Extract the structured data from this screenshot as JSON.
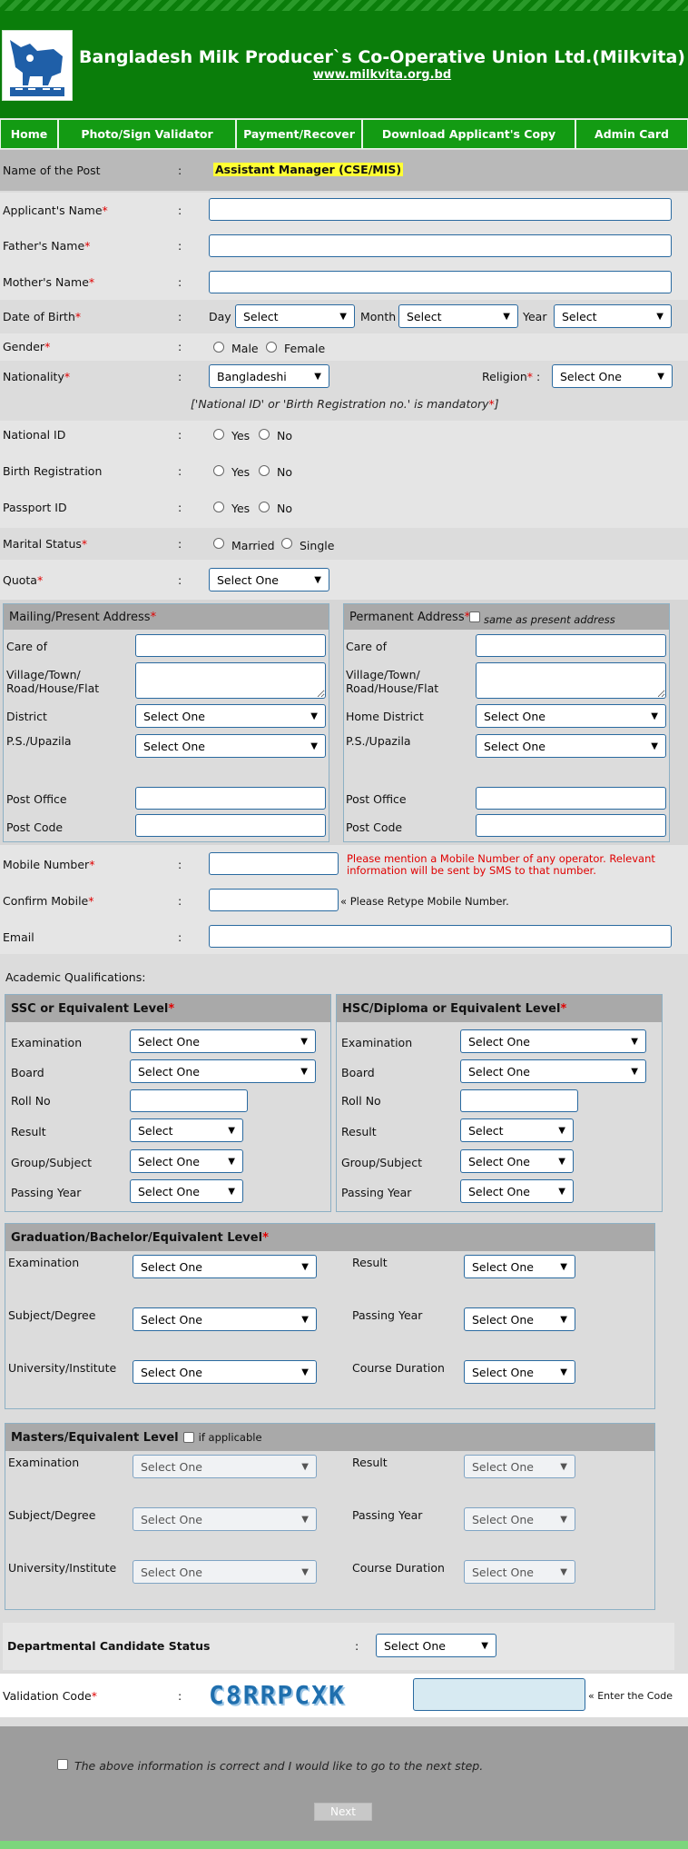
{
  "header": {
    "title": "Bangladesh Milk Producer`s Co-Operative Union Ltd.(Milkvita)",
    "url": "www.milkvita.org.bd",
    "logo_icon": "milkvita-cow-logo"
  },
  "nav": [
    "Home",
    "Photo/Sign Validator",
    "Payment/Recover",
    "Download Applicant's Copy",
    "Admin Card"
  ],
  "post": {
    "label": "Name of the Post",
    "value": "Assistant Manager (CSE/MIS)"
  },
  "colon": ":",
  "star": "*",
  "fields": {
    "applicant_name": "Applicant's Name",
    "father_name": "Father's Name",
    "mother_name": "Mother's Name",
    "dob": "Date of Birth",
    "dob_day": "Day",
    "dob_month": "Month",
    "dob_year": "Year",
    "dob_select": "Select",
    "gender": "Gender",
    "male": "Male",
    "female": "Female",
    "nationality": "Nationality",
    "nationality_value": "Bangladeshi",
    "religion": "Religion",
    "religion_value": "Select One",
    "id_note": "['National ID' or 'Birth Registration no.' is mandatory",
    "id_note_end": "]",
    "national_id": "National ID",
    "birth_reg": "Birth Registration",
    "passport_id": "Passport ID",
    "yes": "Yes",
    "no": "No",
    "marital": "Marital Status",
    "married": "Married",
    "single": "Single",
    "quota": "Quota",
    "select_one": "Select One"
  },
  "address": {
    "mailing_title": "Mailing/Present Address",
    "permanent_title": "Permanent Address",
    "same_as": "same as present address",
    "care_of": "Care of",
    "village1": "Village/Town/",
    "village2": "Road/House/Flat",
    "district": "District",
    "home_district": "Home District",
    "ps": "P.S./Upazila",
    "post_office": "Post Office",
    "post_code": "Post Code"
  },
  "contact": {
    "mobile": "Mobile Number",
    "mobile_hint": "Please mention a Mobile Number of any operator. Relevant information will be sent by SMS to that number.",
    "confirm": "Confirm Mobile",
    "confirm_hint": "« Please Retype Mobile Number.",
    "email": "Email"
  },
  "academic": {
    "heading": "Academic Qualifications:",
    "ssc": "SSC or Equivalent Level",
    "hsc": "HSC/Diploma or Equivalent Level",
    "examination": "Examination",
    "board": "Board",
    "roll": "Roll No",
    "result": "Result",
    "group": "Group/Subject",
    "passing_year": "Passing Year",
    "select": "Select",
    "select_one": "Select One",
    "grad": "Graduation/Bachelor/Equivalent Level",
    "subject_degree": "Subject/Degree",
    "university": "University/Institute",
    "course_duration": "Course Duration",
    "masters": "Masters/Equivalent Level",
    "if_applicable": "if applicable"
  },
  "departmental": {
    "label": "Departmental Candidate Status",
    "value": "Select One"
  },
  "validation": {
    "label": "Validation Code",
    "captcha": "C8RRPCXK",
    "hint": "« Enter the Code"
  },
  "agree": "The above information is correct and I would like to go to the next step.",
  "next": "Next",
  "colors": {
    "header_green": "#0a7d0a",
    "nav_green": "#139b13",
    "required": "#e00000",
    "post_highlight": "#ffff33"
  }
}
